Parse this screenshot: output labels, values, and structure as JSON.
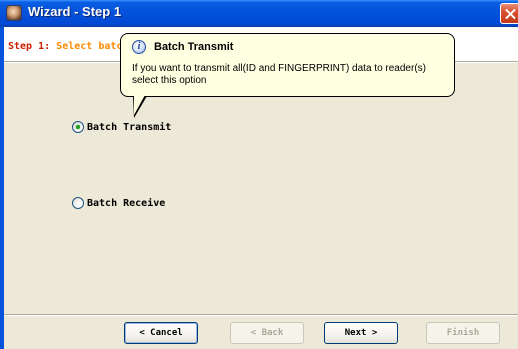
{
  "window": {
    "title": "Wizard - Step 1",
    "app_icon": "user-face-icon",
    "close_icon": "close-icon"
  },
  "header": {
    "step_prefix": "Step 1",
    "step_separator": ": ",
    "step_description": "Select batc",
    "step_prefix_color": "#cc1f00",
    "step_description_color": "#ff8a00"
  },
  "tooltip": {
    "icon": "info-icon",
    "icon_glyph": "i",
    "title": "Batch Transmit",
    "body": "If you want to transmit all(ID and FINGERPRINT) data to reader(s) select this option"
  },
  "options": {
    "transmit": {
      "label": "Batch Transmit",
      "selected": true
    },
    "receive": {
      "label": "Batch Receive",
      "selected": false
    }
  },
  "buttons": {
    "cancel": "< Cancel",
    "back": "< Back",
    "next": "Next >",
    "finish": "Finish"
  },
  "colors": {
    "titlebar": "#0553dc",
    "window_bg": "#ece9d8",
    "tooltip_bg": "#ffffe1",
    "radio_dot": "#21a121",
    "close_button": "#d9502e"
  }
}
